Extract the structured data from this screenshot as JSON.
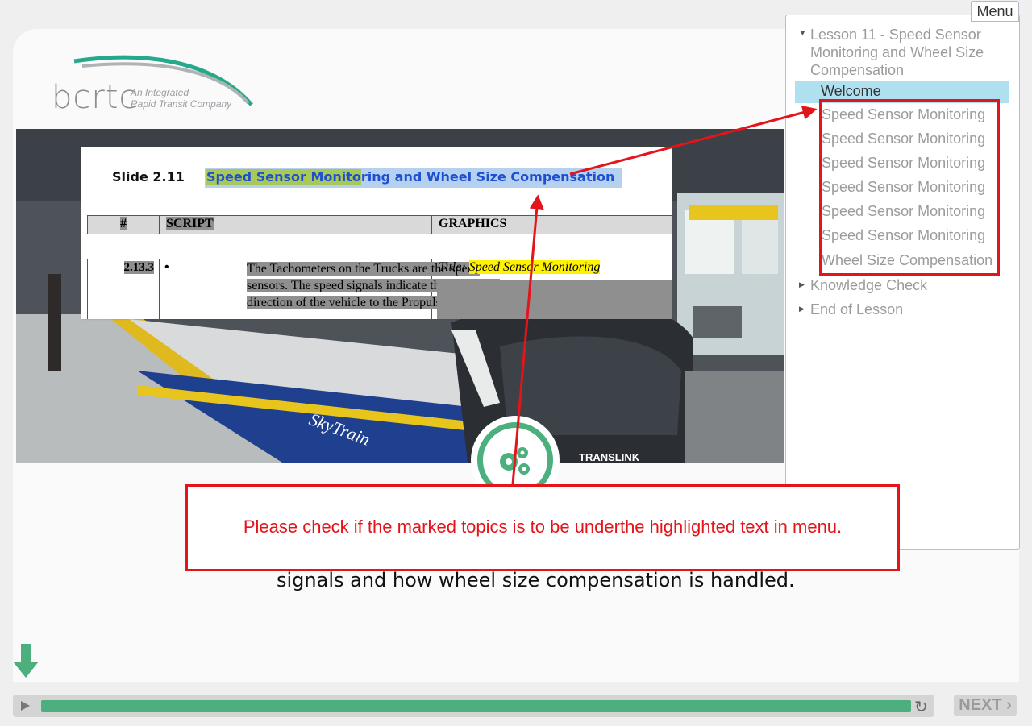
{
  "logo": {
    "word": "bcrtc",
    "tagline_1": "An Integrated",
    "tagline_2": "Rapid Transit Company"
  },
  "doc": {
    "slide_number": "Slide 2.11",
    "slide_title_highlighted": "Speed Sensor Monito",
    "slide_title_rest": "ring and Wheel Size Compensation",
    "headers": {
      "num": "#",
      "script": "SCRIPT",
      "graphics": "GRAPHICS"
    },
    "row_id": "2.13.3",
    "bullet": "•",
    "script_text": "The Tachometers on the Trucks are the speed sensors.  The speed signals indicate the speed and direction of the vehicle to the Propulsion Control",
    "graphics_label": "Title:",
    "graphics_title": "Speed Sensor Monitoring"
  },
  "train_branding": {
    "skytrain": "SkyTrain",
    "translink": "TRANSLINK"
  },
  "caption": "signals and how wheel size compensation is handled.",
  "menu": {
    "button": "Menu",
    "lesson": [
      "Lesson 11 - Speed Sensor",
      "Monitoring and Wheel Size",
      "Compensation"
    ],
    "active": "Welcome",
    "marked_items": [
      "Speed Sensor Monitoring",
      "Speed Sensor Monitoring",
      "Speed Sensor Monitoring",
      "Speed Sensor Monitoring",
      "Speed Sensor Monitoring",
      "Speed Sensor Monitoring",
      "Wheel Size Compensation"
    ],
    "knowledge_check": "Knowledge Check",
    "end_of_lesson": "End of Lesson"
  },
  "annotation": "Please check if the marked topics is to be underthe highlighted text in menu.",
  "player": {
    "progress": 0.99,
    "next_label": "NEXT ›"
  },
  "colors": {
    "accent_green": "#4caf7d",
    "annotation_red": "#e3141a",
    "title_blue": "#1f4fd1",
    "menu_highlight": "#aee0ef"
  }
}
